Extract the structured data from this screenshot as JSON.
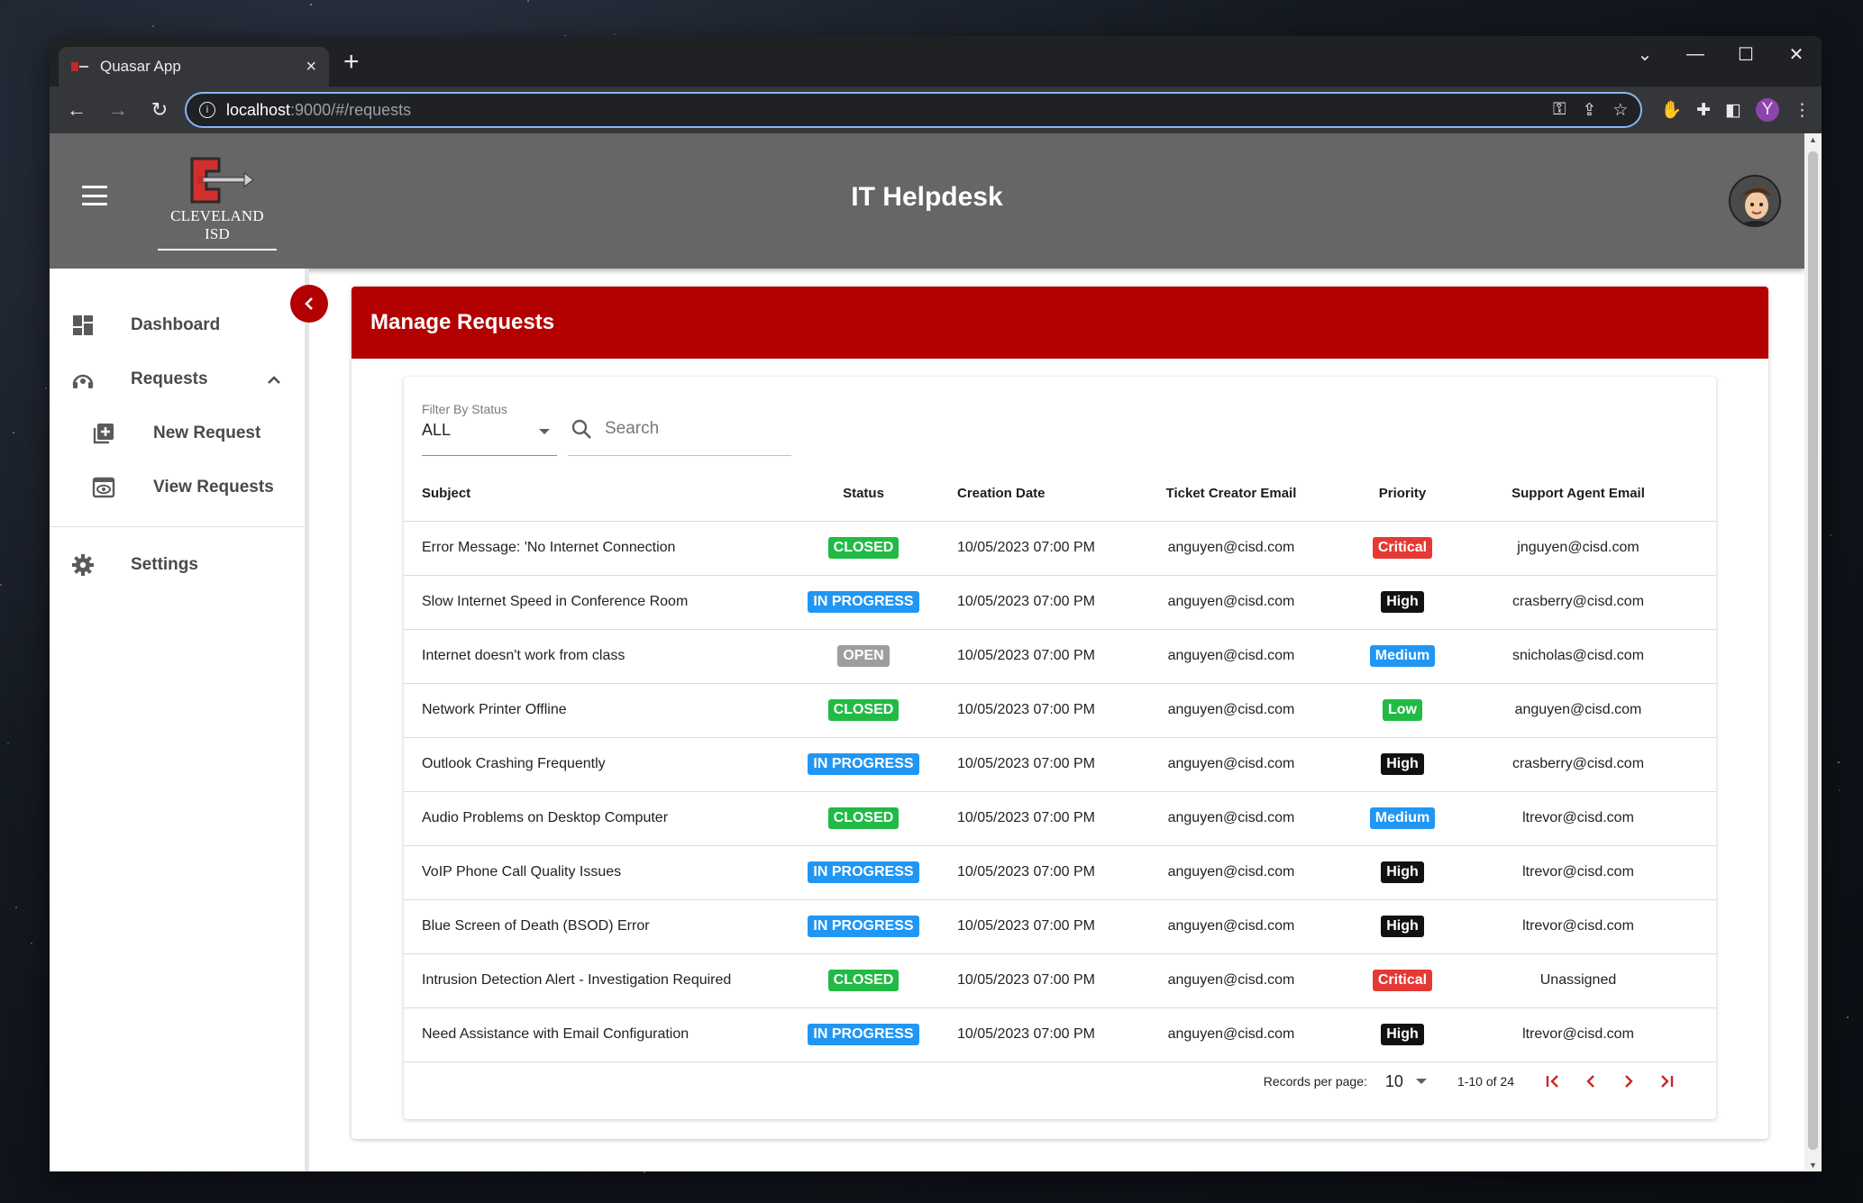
{
  "browser": {
    "tab_title": "Quasar App",
    "url_host": "localhost",
    "url_path": ":9000/#/requests",
    "profile_initial": "Y"
  },
  "app": {
    "title": "IT Helpdesk",
    "logo_text": "CLEVELAND ISD"
  },
  "sidebar": {
    "items": [
      {
        "label": "Dashboard",
        "icon": "dashboard-icon"
      },
      {
        "label": "Requests",
        "icon": "requests-icon"
      },
      {
        "label": "New Request",
        "icon": "add-box-icon"
      },
      {
        "label": "View Requests",
        "icon": "preview-icon"
      },
      {
        "label": "Settings",
        "icon": "gear-icon"
      }
    ]
  },
  "page": {
    "heading": "Manage Requests"
  },
  "filter": {
    "label": "Filter By Status",
    "value": "ALL"
  },
  "search": {
    "placeholder": "Search"
  },
  "table": {
    "columns": [
      "Subject",
      "Status",
      "Creation Date",
      "Ticket Creator Email",
      "Priority",
      "Support Agent Email"
    ],
    "rows": [
      {
        "subject": "Error Message: 'No Internet Connection",
        "status": "CLOSED",
        "date": "10/05/2023 07:00 PM",
        "creator": "anguyen@cisd.com",
        "priority": "Critical",
        "agent": "jnguyen@cisd.com"
      },
      {
        "subject": "Slow Internet Speed in Conference Room",
        "status": "IN PROGRESS",
        "date": "10/05/2023 07:00 PM",
        "creator": "anguyen@cisd.com",
        "priority": "High",
        "agent": "crasberry@cisd.com"
      },
      {
        "subject": "Internet doesn't work from class",
        "status": "OPEN",
        "date": "10/05/2023 07:00 PM",
        "creator": "anguyen@cisd.com",
        "priority": "Medium",
        "agent": "snicholas@cisd.com"
      },
      {
        "subject": "Network Printer Offline",
        "status": "CLOSED",
        "date": "10/05/2023 07:00 PM",
        "creator": "anguyen@cisd.com",
        "priority": "Low",
        "agent": "anguyen@cisd.com"
      },
      {
        "subject": "Outlook Crashing Frequently",
        "status": "IN PROGRESS",
        "date": "10/05/2023 07:00 PM",
        "creator": "anguyen@cisd.com",
        "priority": "High",
        "agent": "crasberry@cisd.com"
      },
      {
        "subject": "Audio Problems on Desktop Computer",
        "status": "CLOSED",
        "date": "10/05/2023 07:00 PM",
        "creator": "anguyen@cisd.com",
        "priority": "Medium",
        "agent": "ltrevor@cisd.com"
      },
      {
        "subject": "VoIP Phone Call Quality Issues",
        "status": "IN PROGRESS",
        "date": "10/05/2023 07:00 PM",
        "creator": "anguyen@cisd.com",
        "priority": "High",
        "agent": "ltrevor@cisd.com"
      },
      {
        "subject": "Blue Screen of Death (BSOD) Error",
        "status": "IN PROGRESS",
        "date": "10/05/2023 07:00 PM",
        "creator": "anguyen@cisd.com",
        "priority": "High",
        "agent": "ltrevor@cisd.com"
      },
      {
        "subject": "Intrusion Detection Alert - Investigation Required",
        "status": "CLOSED",
        "date": "10/05/2023 07:00 PM",
        "creator": "anguyen@cisd.com",
        "priority": "Critical",
        "agent": "Unassigned"
      },
      {
        "subject": "Need Assistance with Email Configuration",
        "status": "IN PROGRESS",
        "date": "10/05/2023 07:00 PM",
        "creator": "anguyen@cisd.com",
        "priority": "High",
        "agent": "ltrevor@cisd.com"
      }
    ]
  },
  "pagination": {
    "records_label": "Records per page:",
    "per_page": "10",
    "range": "1-10 of 24"
  },
  "colors": {
    "brand_red": "#b30000",
    "header_gray": "#676565",
    "status": {
      "CLOSED": "#21ba45",
      "IN PROGRESS": "#2196f3",
      "OPEN": "#9e9e9e"
    },
    "priority": {
      "Critical": "#e53935",
      "High": "#111111",
      "Medium": "#2196f3",
      "Low": "#21ba45"
    }
  }
}
